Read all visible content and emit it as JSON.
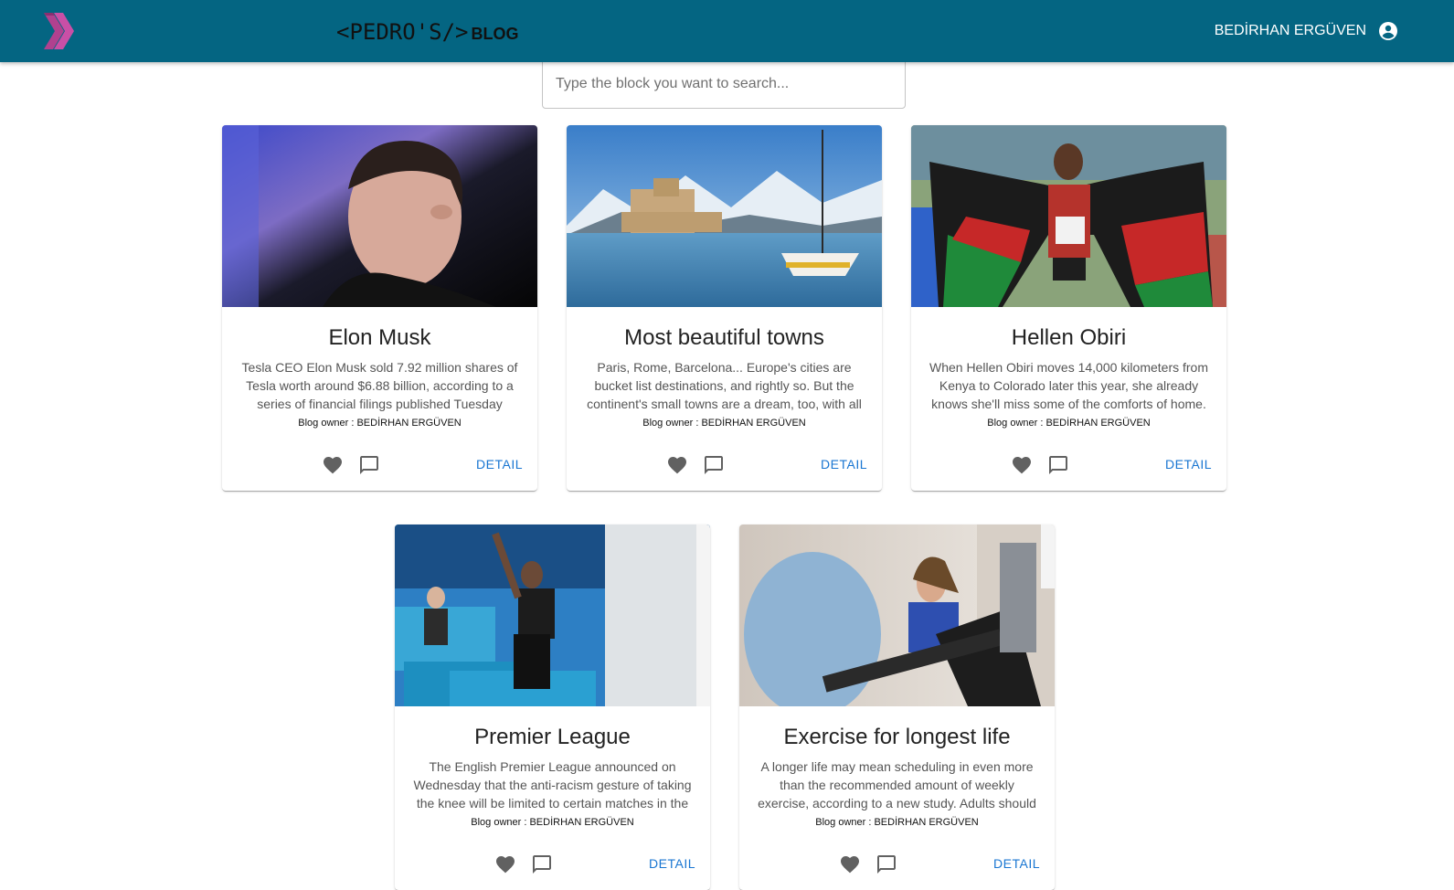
{
  "header": {
    "logo_icon": "double-chevron-logo-icon",
    "brand_text": "<PEDRO'S/>",
    "brand_suffix": "BLOG",
    "user_name": "BEDİRHAN ERGÜVEN",
    "user_icon": "account-circle-icon",
    "bar_color": "#046582"
  },
  "search": {
    "placeholder": "Type the block you want to search...",
    "value": ""
  },
  "cards": [
    {
      "title": "Elon Musk",
      "description": "Tesla CEO Elon Musk sold 7.92 million shares of Tesla worth around $6.88 billion, according to a series of financial filings published Tuesday",
      "owner": "Blog owner : BEDİRHAN ERGÜVEN",
      "image": "portrait-photo",
      "detail_label": "DETAIL"
    },
    {
      "title": "Most beautiful towns",
      "description": "Paris, Rome, Barcelona... Europe's cities are bucket list destinations, and rightly so. But the continent's small towns are a dream, too, with all",
      "owner": "Blog owner : BEDİRHAN ERGÜVEN",
      "image": "coastal-town-photo",
      "detail_label": "DETAIL"
    },
    {
      "title": "Hellen Obiri",
      "description": "When Hellen Obiri moves 14,000 kilometers from Kenya to Colorado later this year, she already knows she'll miss some of the comforts of home.",
      "owner": "Blog owner : BEDİRHAN ERGÜVEN",
      "image": "athlete-flag-photo",
      "detail_label": "DETAIL"
    },
    {
      "title": "Premier League",
      "description": "The English Premier League announced on Wednesday that the anti-racism gesture of taking the knee will be limited to certain matches in the",
      "owner": "Blog owner : BEDİRHAN ERGÜVEN",
      "image": "football-kneel-photo",
      "detail_label": "DETAIL"
    },
    {
      "title": "Exercise for longest life",
      "description": "A longer life may mean scheduling in even more than the recommended amount of weekly exercise, according to a new study. Adults should",
      "owner": "Blog owner : BEDİRHAN ERGÜVEN",
      "image": "gym-cycling-photo",
      "detail_label": "DETAIL"
    }
  ],
  "icons": {
    "favorite": "heart-icon",
    "comment": "chat-bubble-icon"
  },
  "colors": {
    "link": "#1976d2",
    "icon_gray": "#616161"
  }
}
